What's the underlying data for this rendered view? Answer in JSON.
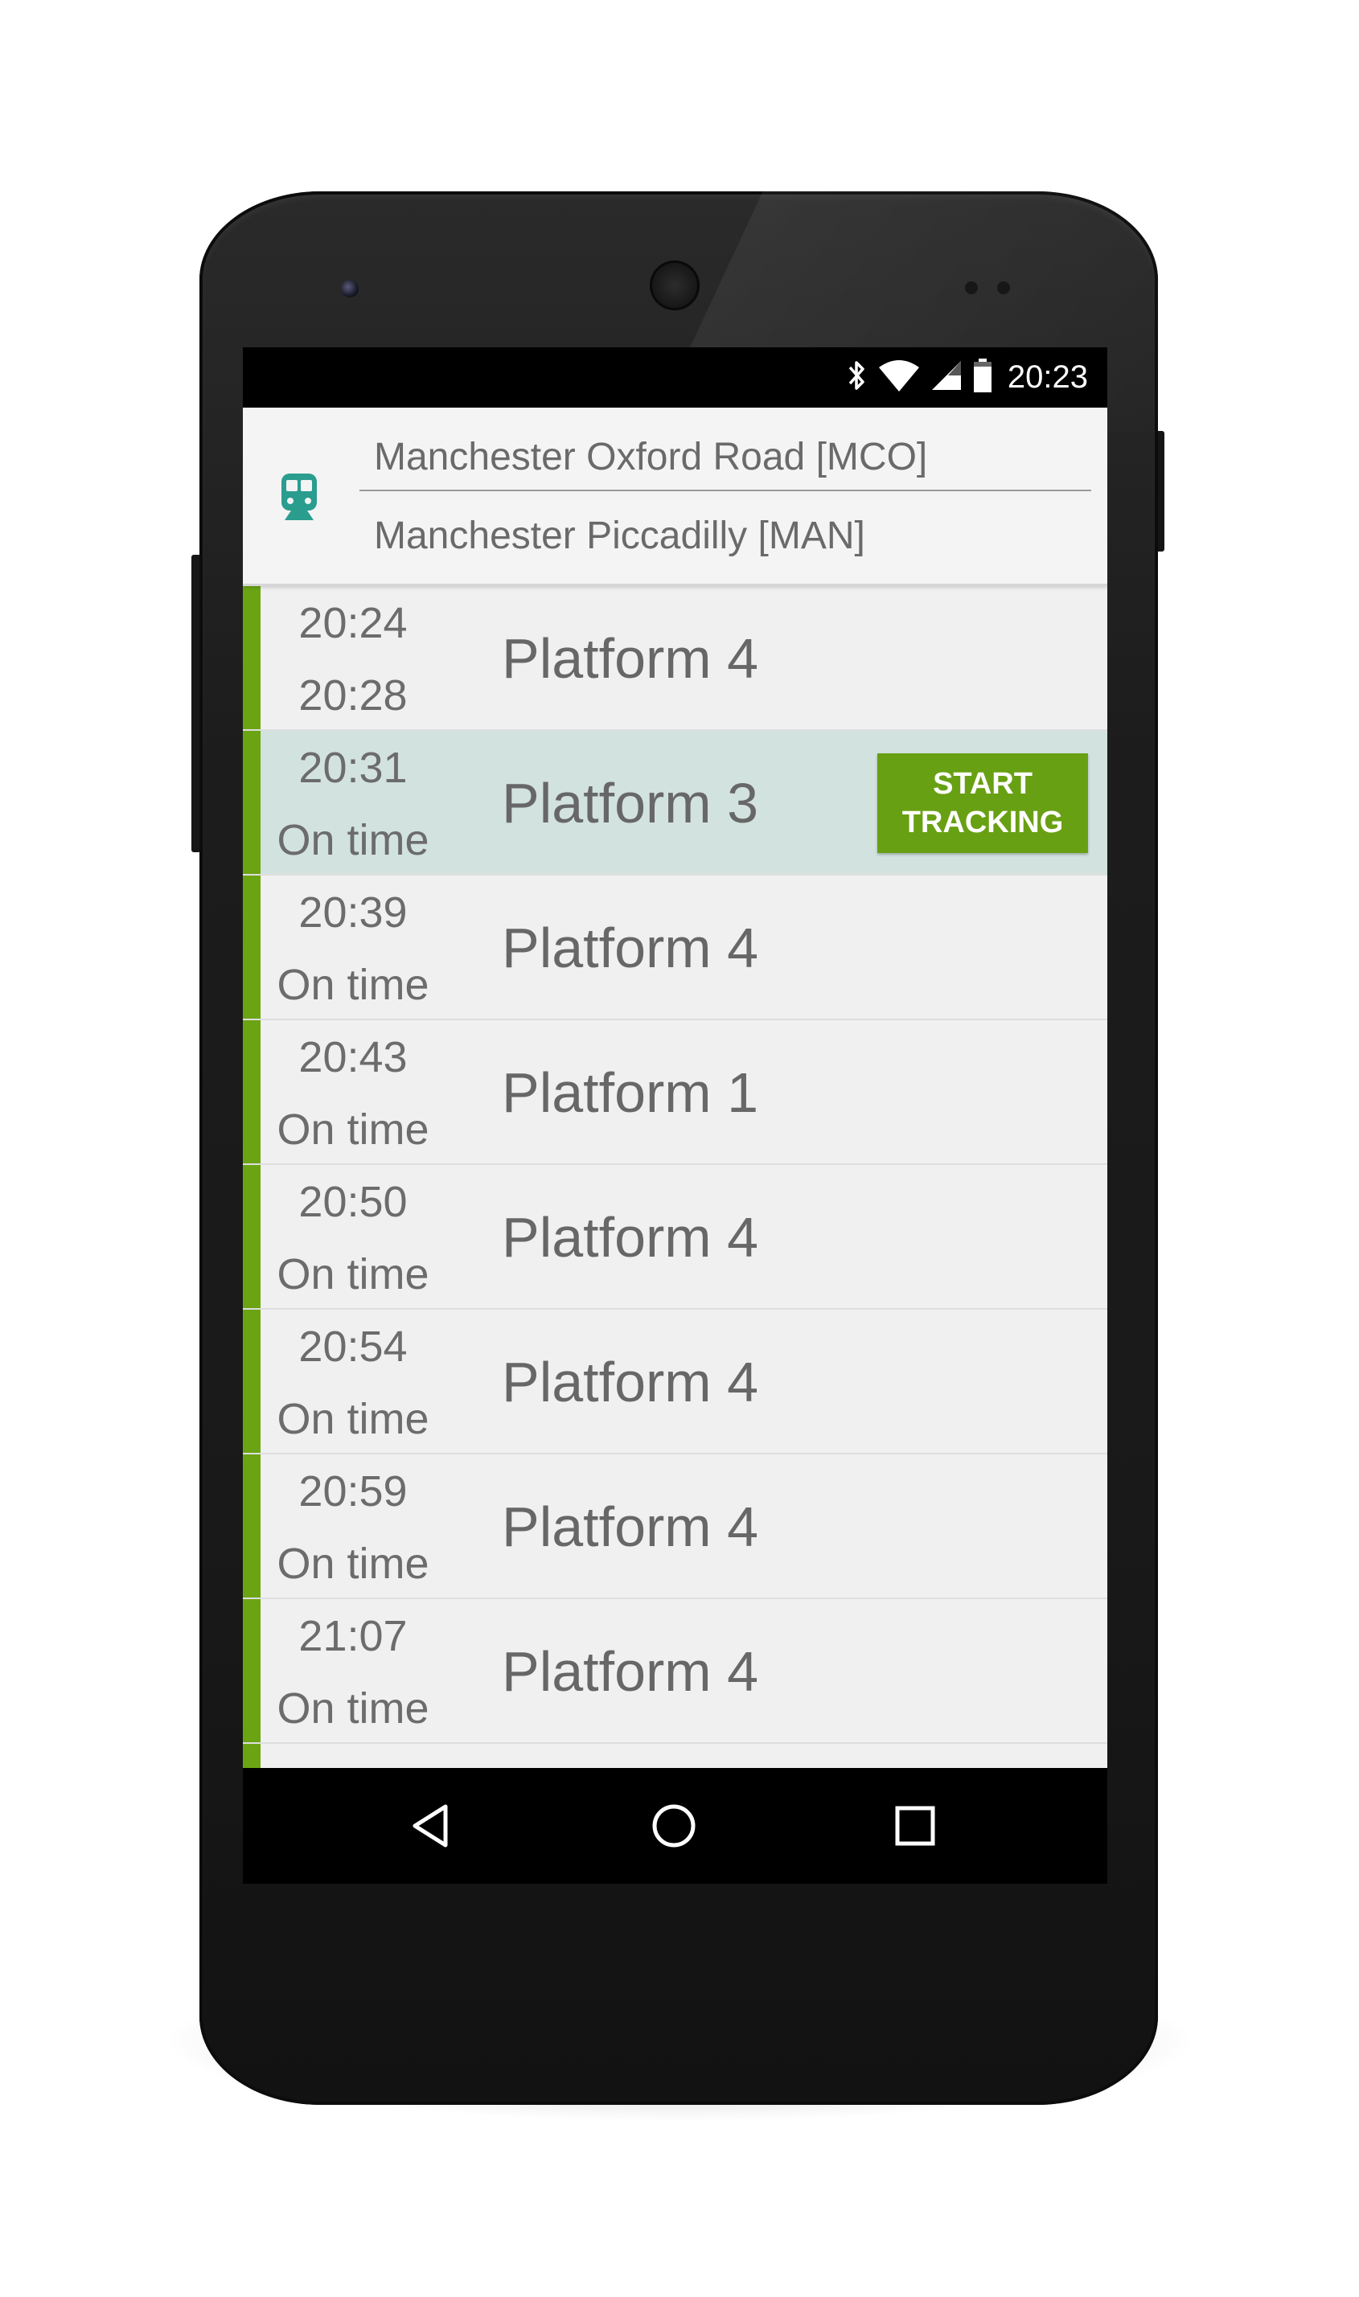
{
  "status_bar": {
    "time": "20:23",
    "icons": [
      "bluetooth-icon",
      "wifi-icon",
      "signal-icon",
      "battery-icon"
    ]
  },
  "journey": {
    "from_station": "Manchester Oxford Road [MCO]",
    "to_station": "Manchester Piccadilly [MAN]",
    "icon": "train-icon"
  },
  "departures": [
    {
      "time": "20:24",
      "status": "20:28",
      "platform": "Platform 4",
      "selected": false
    },
    {
      "time": "20:31",
      "status": "On time",
      "platform": "Platform 3",
      "selected": true
    },
    {
      "time": "20:39",
      "status": "On time",
      "platform": "Platform 4",
      "selected": false
    },
    {
      "time": "20:43",
      "status": "On time",
      "platform": "Platform 1",
      "selected": false
    },
    {
      "time": "20:50",
      "status": "On time",
      "platform": "Platform 4",
      "selected": false
    },
    {
      "time": "20:54",
      "status": "On time",
      "platform": "Platform 4",
      "selected": false
    },
    {
      "time": "20:59",
      "status": "On time",
      "platform": "Platform 4",
      "selected": false
    },
    {
      "time": "21:07",
      "status": "On time",
      "platform": "Platform 4",
      "selected": false
    }
  ],
  "track_button": {
    "line1": "START",
    "line2": "TRACKING"
  },
  "colors": {
    "accent": "#6aa413",
    "selected_row": "#d2e2df",
    "train_icon": "#2a9d8f"
  },
  "nav_bar": [
    "back-icon",
    "home-icon",
    "recents-icon"
  ]
}
